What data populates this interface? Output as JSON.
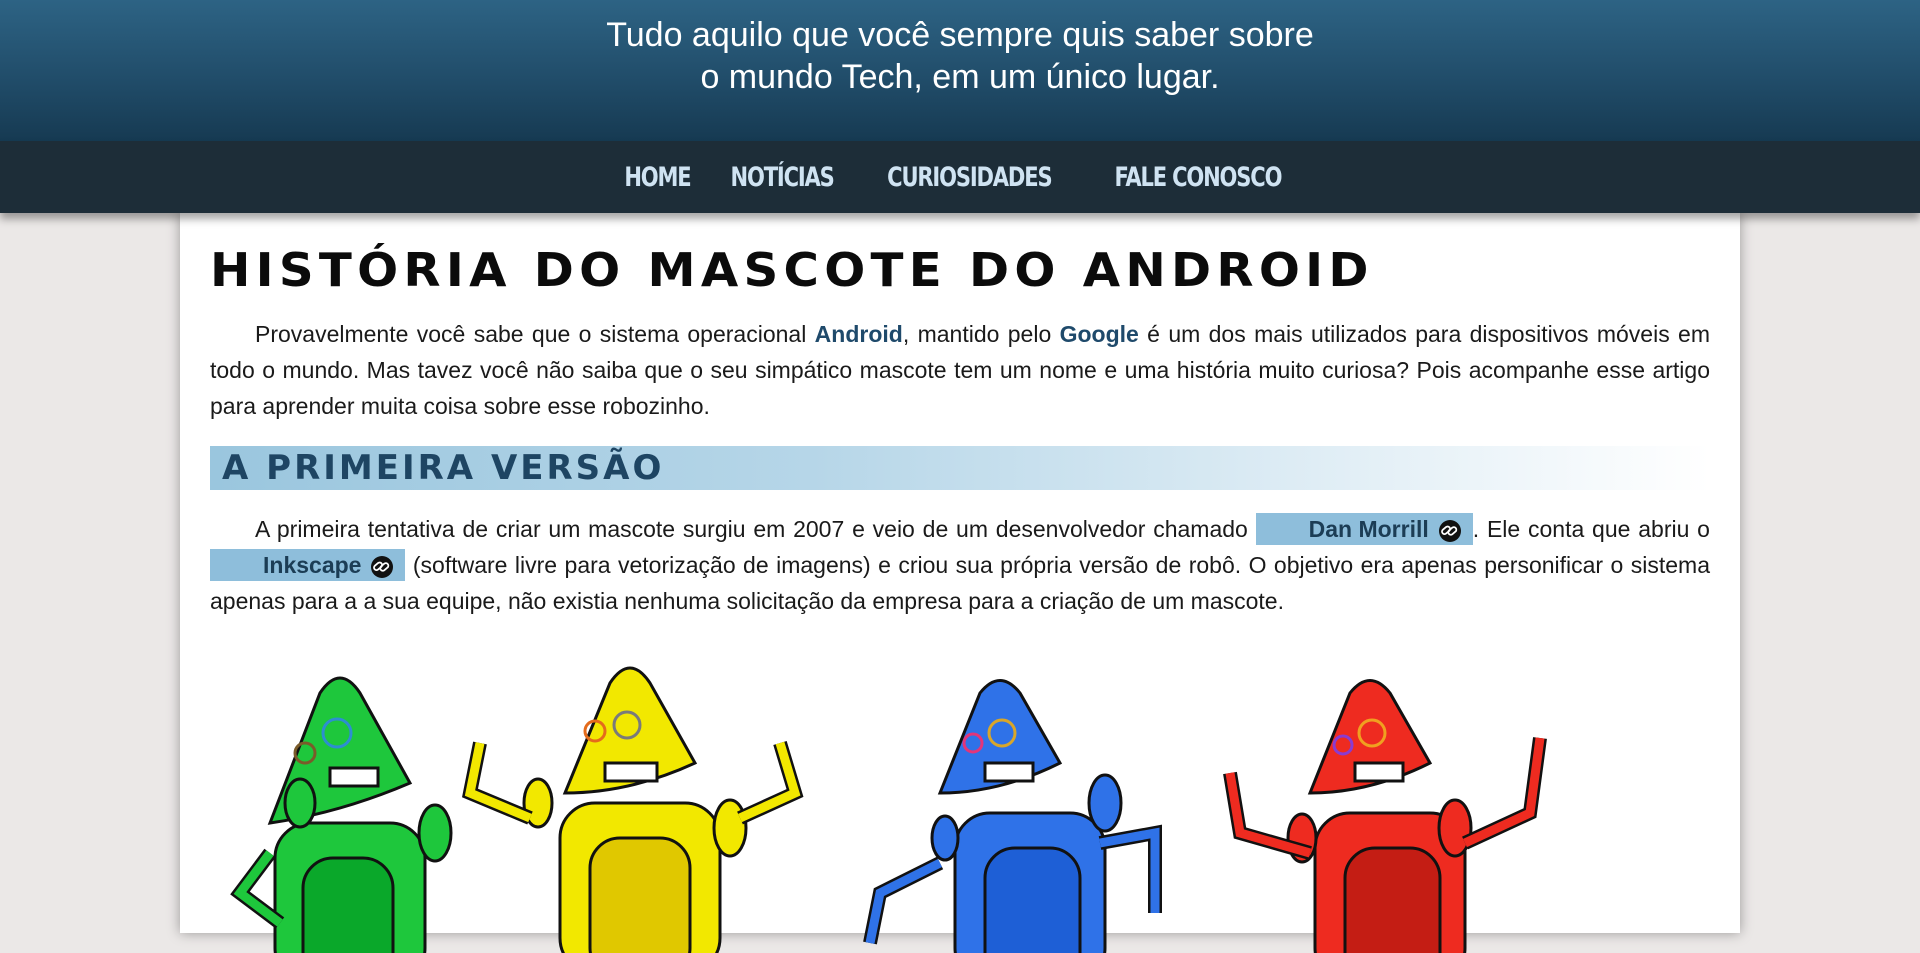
{
  "header": {
    "tagline_line1": "Tudo aquilo que você sempre quis saber sobre",
    "tagline_line2": "o mundo Tech, em um único lugar."
  },
  "nav": {
    "items": [
      "HOME",
      "NOTÍCIAS",
      "CURIOSIDADES",
      "FALE CONOSCO"
    ]
  },
  "article": {
    "title": "História do mascote do Android",
    "intro": {
      "part1": "Provavelmente você sabe que o sistema operacional ",
      "android": "Android",
      "part2": ", mantido pelo ",
      "google": "Google",
      "part3": " é um dos mais utilizados para dispositivos móveis em todo o mundo. Mas tavez você não saiba que o seu simpático mascote tem um nome e uma história muito curiosa? Pois acompanhe esse artigo para aprender muita coisa sobre esse robozinho."
    },
    "section1": {
      "title": "A primeira versão",
      "part1": "A primeira tentativa de criar um mascote surgiu em 2007 e veio de um desenvolvedor chamado ",
      "link1": "Dan Morrill",
      "part2": ". Ele conta que abriu o ",
      "link2": "Inkscape",
      "part3": " (software livre para vetorização de imagens) e criou sua própria versão de robô. O objetivo era apenas personificar o sistema apenas para a a sua equipe, não existia nenhuma solicitação da empresa para a criação de um mascote."
    },
    "robot_colors": [
      "#1ec73c",
      "#f2e800",
      "#2f72e8",
      "#ee2b20"
    ],
    "link_icon": "chain-link-icon"
  }
}
